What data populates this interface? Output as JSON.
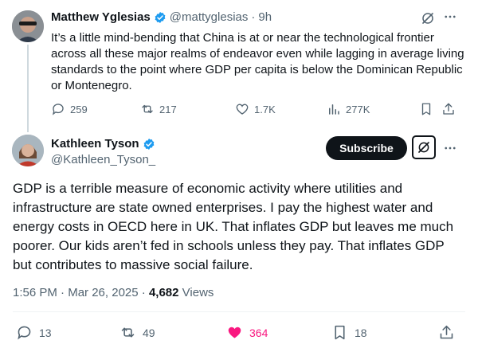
{
  "parent_tweet": {
    "author_name": "Matthew Yglesias",
    "handle": "@mattyglesias",
    "separator": "·",
    "time_ago": "9h",
    "text": "It’s a little mind-bending that China is at or near the technological frontier across all these major realms of endeavor even while lagging in average living standards to the point where GDP per capita is below the Dominican Republic or Montenegro.",
    "replies": "259",
    "reposts": "217",
    "likes": "1.7K",
    "views": "277K"
  },
  "main_tweet": {
    "author_name": "Kathleen Tyson",
    "handle": "@Kathleen_Tyson_",
    "subscribe_label": "Subscribe",
    "text": "GDP is a terrible measure of economic activity where utilities and infrastructure are state owned enterprises. I pay the highest water and energy costs in OECD here in UK. That inflates GDP but leaves me much poorer. Our kids aren’t fed in schools unless they pay. That inflates GDP but contributes to massive social failure.",
    "time": "1:56 PM",
    "date": "Mar 26, 2025",
    "meta_separator": " · ",
    "views_count": "4,682",
    "views_label": "Views",
    "replies": "13",
    "reposts": "49",
    "likes": "364",
    "bookmarks": "18"
  },
  "colors": {
    "text_primary": "#0f1419",
    "text_secondary": "#536471",
    "verified_blue": "#1d9bf0",
    "like_pink": "#f91880",
    "border": "#cfd9de"
  },
  "icons": [
    "verified-badge-icon",
    "grok-icon",
    "more-icon",
    "reply-icon",
    "repost-icon",
    "like-icon",
    "views-icon",
    "bookmark-icon",
    "share-icon"
  ]
}
